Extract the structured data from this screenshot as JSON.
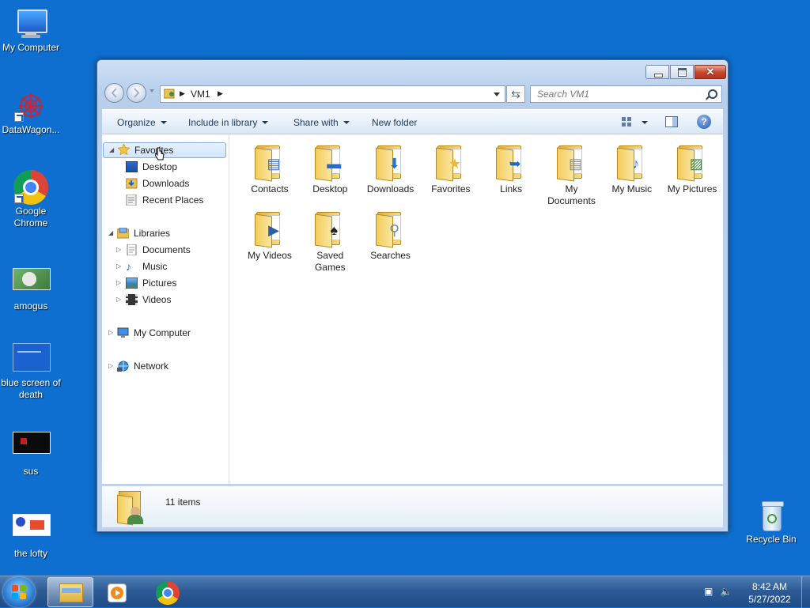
{
  "desktop": {
    "icons": [
      {
        "label": "My Computer",
        "icon": "computer-icon"
      },
      {
        "label": "DataWagon...",
        "icon": "datawagon-shortcut-icon"
      },
      {
        "label": "Google Chrome",
        "icon": "chrome-icon"
      },
      {
        "label": "amogus",
        "icon": "image-thumbnail-icon"
      },
      {
        "label": "blue screen of death",
        "icon": "image-thumbnail-icon"
      },
      {
        "label": "sus",
        "icon": "image-thumbnail-icon"
      },
      {
        "label": "the lofty",
        "icon": "image-thumbnail-icon"
      },
      {
        "label": "Recycle Bin",
        "icon": "recycle-bin-icon"
      }
    ]
  },
  "window": {
    "address": {
      "crumb": "VM1"
    },
    "search_placeholder": "Search VM1",
    "commands": {
      "organize": "Organize",
      "include": "Include in library",
      "share": "Share with",
      "new_folder": "New folder"
    },
    "nav": {
      "favorites": "Favorites",
      "desktop": "Desktop",
      "downloads": "Downloads",
      "recent": "Recent Places",
      "libraries": "Libraries",
      "documents": "Documents",
      "music": "Music",
      "pictures": "Pictures",
      "videos": "Videos",
      "computer": "My Computer",
      "network": "Network"
    },
    "items": [
      {
        "label": "Contacts",
        "icon": "contacts-folder-icon"
      },
      {
        "label": "Desktop",
        "icon": "desktop-folder-icon"
      },
      {
        "label": "Downloads",
        "icon": "downloads-folder-icon"
      },
      {
        "label": "Favorites",
        "icon": "favorites-folder-icon"
      },
      {
        "label": "Links",
        "icon": "links-folder-icon"
      },
      {
        "label": "My Documents",
        "icon": "documents-folder-icon"
      },
      {
        "label": "My Music",
        "icon": "music-folder-icon"
      },
      {
        "label": "My Pictures",
        "icon": "pictures-folder-icon"
      },
      {
        "label": "My Videos",
        "icon": "videos-folder-icon"
      },
      {
        "label": "Saved Games",
        "icon": "saved-games-folder-icon"
      },
      {
        "label": "Searches",
        "icon": "searches-folder-icon"
      }
    ],
    "details": {
      "count": "11 items"
    }
  },
  "taskbar": {
    "clock_time": "8:42 AM",
    "clock_date": "5/27/2022"
  },
  "colors": {
    "desktop": "#0e6fd0",
    "selection": "#cfe4fb",
    "accent": "#1e395b"
  }
}
